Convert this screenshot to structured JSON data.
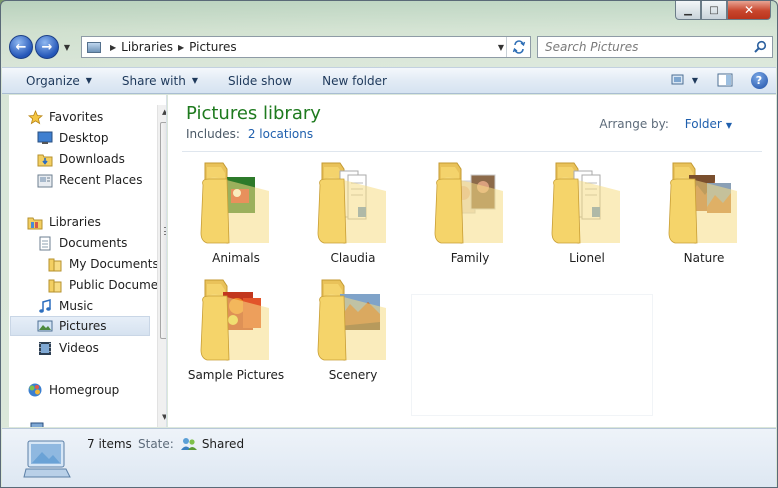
{
  "window": {
    "caption_min": "▁",
    "caption_max": "□",
    "caption_close": "✕"
  },
  "address": {
    "crumbs": [
      "Libraries",
      "Pictures"
    ],
    "back": "←",
    "forward": "→"
  },
  "search": {
    "placeholder": "Search Pictures"
  },
  "toolbar": {
    "organize": "Organize",
    "share_with": "Share with",
    "slide_show": "Slide show",
    "new_folder": "New folder",
    "help": "?"
  },
  "nav": {
    "favorites": "Favorites",
    "desktop": "Desktop",
    "downloads": "Downloads",
    "recent_places": "Recent Places",
    "libraries": "Libraries",
    "documents": "Documents",
    "my_documents": "My Documents",
    "public_documents": "Public Documents",
    "music": "Music",
    "pictures": "Pictures",
    "videos": "Videos",
    "homegroup": "Homegroup"
  },
  "content": {
    "title": "Pictures library",
    "includes_label": "Includes:",
    "includes_link": "2 locations",
    "arrange_label": "Arrange by:",
    "arrange_value": "Folder",
    "folders": [
      {
        "label": "Animals",
        "kind": "photo-red"
      },
      {
        "label": "Claudia",
        "kind": "docs"
      },
      {
        "label": "Family",
        "kind": "photo-people"
      },
      {
        "label": "Lionel",
        "kind": "docs"
      },
      {
        "label": "Nature",
        "kind": "photo-canyon"
      },
      {
        "label": "Sample Pictures",
        "kind": "photo-flower"
      },
      {
        "label": "Scenery",
        "kind": "photo-canyon2"
      }
    ]
  },
  "status": {
    "count": "7 items",
    "state_label": "State:",
    "state_value": "Shared"
  },
  "colors": {
    "title_green": "#1e7a1e",
    "link_blue": "#1f5fad",
    "folder_yellow": "#f5d46a"
  }
}
